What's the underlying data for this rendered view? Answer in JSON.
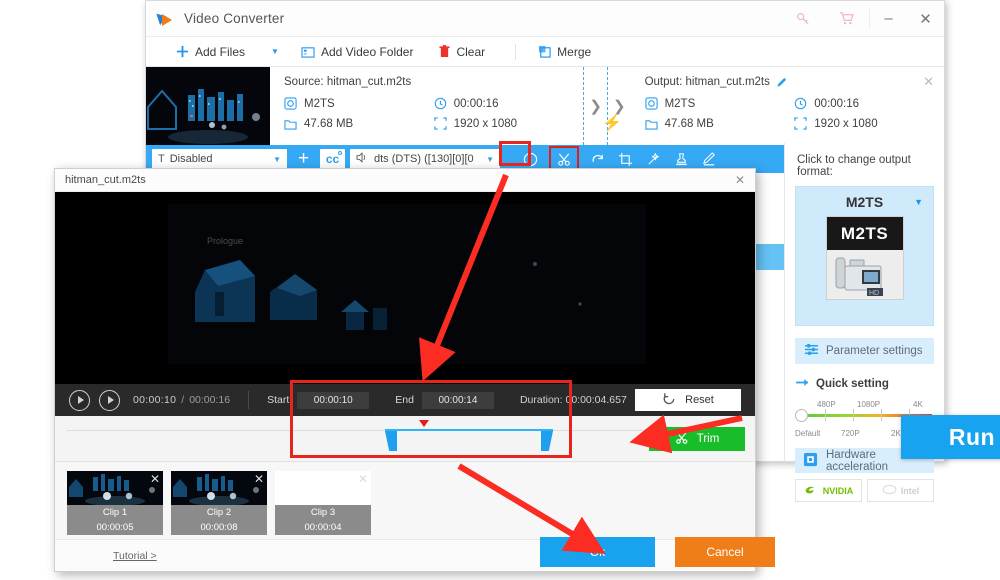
{
  "app": {
    "title": "Video Converter",
    "window_controls": {
      "key_icon": "key-icon",
      "cart_icon": "cart-icon",
      "minimize": "–",
      "close": "✕"
    }
  },
  "menubar": {
    "items": [
      {
        "label": "Add Files",
        "icon": "plus-icon"
      },
      {
        "label": "Add Video Folder",
        "icon": "folder-video-icon"
      },
      {
        "label": "Clear",
        "icon": "trash-icon"
      },
      {
        "label": "Merge",
        "icon": "merge-icon"
      }
    ],
    "dropdown_caret": "▼"
  },
  "file_card": {
    "source": {
      "title": "Source: hitman_cut.m2ts",
      "format": "M2TS",
      "duration": "00:00:16",
      "size": "47.68 MB",
      "resolution": "1920 x 1080"
    },
    "output": {
      "title": "Output: hitman_cut.m2ts",
      "format": "M2TS",
      "duration": "00:00:16",
      "size": "47.68 MB",
      "resolution": "1920 x 1080",
      "edit_icon": "pencil-icon"
    },
    "close_icon": "✕",
    "bolt_icon": "⚡",
    "chevron": "❯"
  },
  "action_toolbar": {
    "subtitle_value": "Disabled",
    "subtitle_icon": "subtitle-T-icon",
    "audio_value": "dts (DTS) ([130][0][0",
    "audio_icon": "speaker-icon",
    "add_icon": "plus-icon",
    "cc_label": "cc",
    "buttons": [
      {
        "name": "info-icon",
        "glyph": "i"
      },
      {
        "name": "cut-icon",
        "glyph": "scissors"
      },
      {
        "name": "rotate-icon",
        "glyph": "rotate"
      },
      {
        "name": "crop-icon",
        "glyph": "crop"
      },
      {
        "name": "effect-icon",
        "glyph": "wand"
      },
      {
        "name": "watermark-icon",
        "glyph": "stamp"
      },
      {
        "name": "subtitle-edit-icon",
        "glyph": "edit"
      }
    ]
  },
  "right_panel": {
    "label": "Click to change output format:",
    "format": "M2TS",
    "format_thumb_label": "M2TS",
    "caret": "▼",
    "parameter_settings": "Parameter settings",
    "quick_setting": "Quick setting",
    "slider": {
      "top_labels": [
        "480P",
        "1080P",
        "4K"
      ],
      "bottom_labels": [
        "Default",
        "720P",
        "2K"
      ],
      "value": "Default"
    },
    "hardware_acceleration": "Hardware acceleration",
    "gpus": [
      {
        "label": "NVIDIA",
        "enabled": true
      },
      {
        "label": "Intel",
        "enabled": false
      }
    ]
  },
  "run": {
    "label": "Run",
    "alarm_icon": "alarm-clock-icon"
  },
  "dialog": {
    "title": "hitman_cut.m2ts",
    "close_icon": "✕",
    "player": {
      "play_icon": "play-circle-icon",
      "next_frame_icon": "next-frame-icon",
      "current_time": "00:00:10",
      "separator": "/",
      "total_time": "00:00:16",
      "start_label": "Start",
      "start_value": "00:00:10",
      "end_label": "End",
      "end_value": "00:00:14",
      "duration_label": "Duration: 00:00:04.657",
      "reset_label": "Reset",
      "reset_icon": "refresh-icon"
    },
    "trim_button": {
      "label": "Trim",
      "icon": "scissors-icon"
    },
    "clips": [
      {
        "name": "Clip 1",
        "duration": "00:00:05",
        "blank": false
      },
      {
        "name": "Clip 2",
        "duration": "00:00:08",
        "blank": false
      },
      {
        "name": "Clip 3",
        "duration": "00:00:04",
        "blank": true
      }
    ],
    "footer": {
      "tutorial": "Tutorial >",
      "ok": "Ok",
      "cancel": "Cancel"
    }
  },
  "colors": {
    "accent_blue": "#36a9f4",
    "run_blue": "#17a3ef",
    "trim_green": "#19bd2a",
    "cancel_orange": "#ef7e18",
    "annotation_red": "#e8251d"
  }
}
